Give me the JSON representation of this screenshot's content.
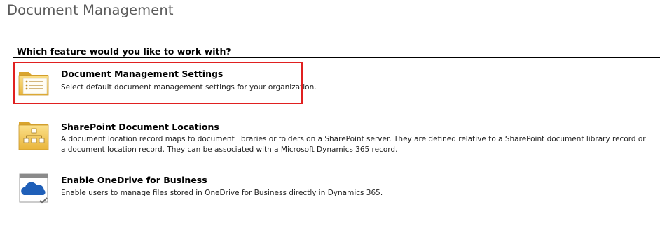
{
  "page": {
    "title": "Document Management"
  },
  "section": {
    "heading": "Which feature would you like to work with?"
  },
  "features": [
    {
      "title": "Document Management Settings",
      "description": "Select default document management settings for your organization.",
      "icon": "settings-list-icon"
    },
    {
      "title": "SharePoint Document Locations",
      "description": "A document location record maps to document libraries or folders on a SharePoint server. They are defined relative to a SharePoint document library record or a document location record. They can be associated with a Microsoft Dynamics 365 record.",
      "icon": "sitemap-folder-icon"
    },
    {
      "title": "Enable OneDrive for Business",
      "description": "Enable users to manage files stored in OneDrive for Business directly in Dynamics 365.",
      "icon": "onedrive-cloud-icon"
    }
  ],
  "colors": {
    "highlight": "#e02020",
    "folder": "#f2c14e",
    "cloud": "#1f5fb8"
  }
}
